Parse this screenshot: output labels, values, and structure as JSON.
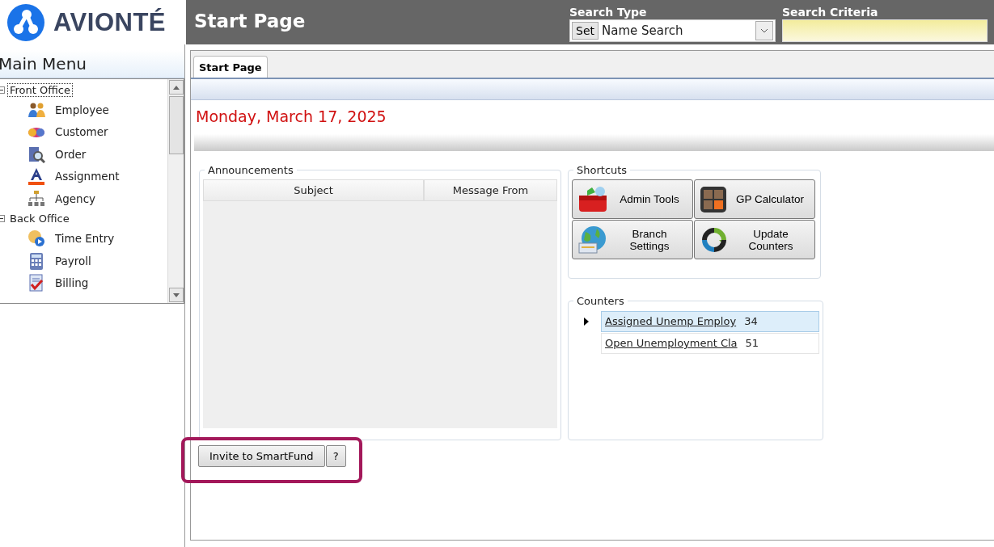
{
  "logo": {
    "text": "AVIONTÉ"
  },
  "header": {
    "title": "Start Page",
    "search_type": {
      "label": "Search Type",
      "set_button": "Set",
      "value": "Name Search"
    },
    "search_criteria": {
      "label": "Search Criteria"
    }
  },
  "sidebar": {
    "title": "Main Menu",
    "tree": [
      {
        "label": "Front Office",
        "expanded": true,
        "selected": true,
        "children": [
          {
            "label": "Employee",
            "selected": false
          },
          {
            "label": "Customer",
            "selected": false
          },
          {
            "label": "Order",
            "selected": false
          },
          {
            "label": "Assignment",
            "selected": false
          },
          {
            "label": "Agency",
            "selected": false
          }
        ]
      },
      {
        "label": "Back Office",
        "expanded": true,
        "selected": false,
        "children": [
          {
            "label": "Time Entry",
            "selected": false
          },
          {
            "label": "Payroll",
            "selected": false
          },
          {
            "label": "Billing",
            "selected": false
          }
        ]
      }
    ]
  },
  "tabs": [
    {
      "label": "Start Page",
      "selected": true
    }
  ],
  "date": "Monday, March 17, 2025",
  "announcements": {
    "title": "Announcements",
    "columns": [
      "Subject",
      "Message From"
    ]
  },
  "shortcuts": {
    "title": "Shortcuts",
    "buttons": [
      "Admin Tools",
      "GP Calculator",
      "Branch Settings",
      "Update Counters"
    ]
  },
  "counters": {
    "title": "Counters",
    "rows": [
      {
        "name": "Assigned Unemp Employ",
        "count": "34",
        "selected": true
      },
      {
        "name": "Open Unemployment Cla",
        "count": "51",
        "selected": false
      }
    ]
  },
  "actions": {
    "invite_button": "Invite to SmartFund",
    "help_button": "?"
  }
}
